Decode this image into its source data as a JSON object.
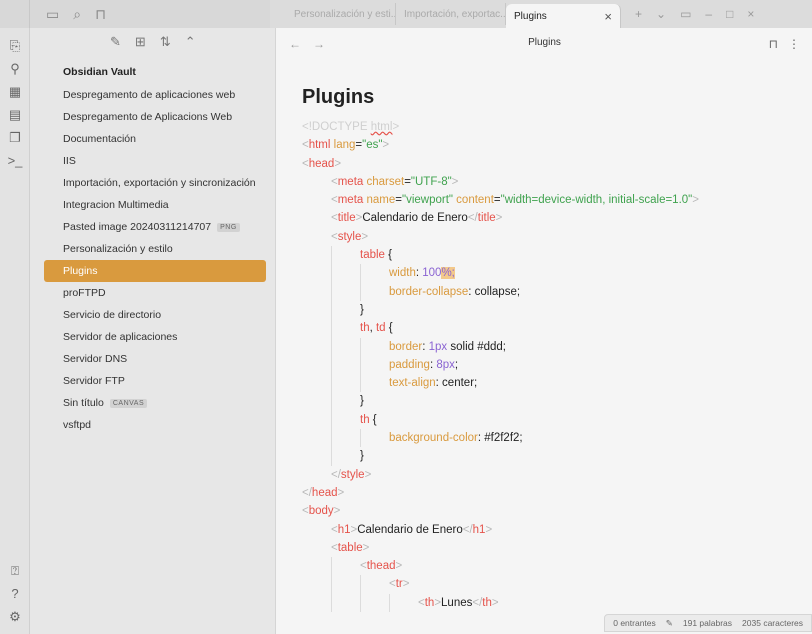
{
  "tabs": [
    {
      "label": "Personalización y esti..."
    },
    {
      "label": "Importación, exportac..."
    },
    {
      "label": "Plugins"
    }
  ],
  "view": {
    "title": "Plugins"
  },
  "sidebar": {
    "vault_name": "Obsidian Vault",
    "files": [
      {
        "name": "Despregamento de aplicaciones web",
        "badge": null
      },
      {
        "name": "Despregamento de Aplicacions Web",
        "badge": null
      },
      {
        "name": "Documentación",
        "badge": null
      },
      {
        "name": "IIS",
        "badge": null
      },
      {
        "name": "Importación, exportación y sincronización",
        "badge": null
      },
      {
        "name": "Integracion Multimedia",
        "badge": null
      },
      {
        "name": "Pasted image 20240311214707",
        "badge": "PNG"
      },
      {
        "name": "Personalización y estilo",
        "badge": null
      },
      {
        "name": "Plugins",
        "badge": null,
        "selected": true
      },
      {
        "name": "proFTPD",
        "badge": null
      },
      {
        "name": "Servicio de directorio",
        "badge": null
      },
      {
        "name": "Servidor de aplicaciones",
        "badge": null
      },
      {
        "name": "Servidor DNS",
        "badge": null
      },
      {
        "name": "Servidor FTP",
        "badge": null
      },
      {
        "name": "Sin título",
        "badge": "CANVAS"
      },
      {
        "name": "vsftpd",
        "badge": null
      }
    ]
  },
  "note": {
    "title": "Plugins",
    "code_lines": [
      {
        "indent": 0,
        "parts": [
          [
            "<!DOCTYPE ",
            "faint"
          ],
          [
            "html",
            "faint squiggle"
          ],
          [
            ">",
            "faint"
          ]
        ]
      },
      {
        "indent": 0,
        "parts": [
          [
            "<",
            "punct"
          ],
          [
            "html ",
            "tag"
          ],
          [
            "lang",
            "attr"
          ],
          [
            "=",
            "text"
          ],
          [
            "\"es\"",
            "str"
          ],
          [
            ">",
            "punct"
          ]
        ]
      },
      {
        "indent": 0,
        "parts": [
          [
            "<",
            "punct"
          ],
          [
            "head",
            "tag"
          ],
          [
            ">",
            "punct"
          ]
        ]
      },
      {
        "indent": 1,
        "parts": [
          [
            "<",
            "punct"
          ],
          [
            "meta ",
            "tag"
          ],
          [
            "charset",
            "attr"
          ],
          [
            "=",
            "text"
          ],
          [
            "\"UTF-8\"",
            "str"
          ],
          [
            ">",
            "punct"
          ]
        ]
      },
      {
        "indent": 1,
        "parts": [
          [
            "<",
            "punct"
          ],
          [
            "meta ",
            "tag"
          ],
          [
            "name",
            "attr"
          ],
          [
            "=",
            "text"
          ],
          [
            "\"viewport\" ",
            "str"
          ],
          [
            "content",
            "attr"
          ],
          [
            "=",
            "text"
          ],
          [
            "\"width=device-width, initial-scale=1.0\"",
            "str"
          ],
          [
            ">",
            "punct"
          ]
        ]
      },
      {
        "indent": 1,
        "parts": [
          [
            "<",
            "punct"
          ],
          [
            "title",
            "tag"
          ],
          [
            ">",
            "punct"
          ],
          [
            "Calendario de Enero",
            "text"
          ],
          [
            "</",
            "punct"
          ],
          [
            "title",
            "tag"
          ],
          [
            ">",
            "punct"
          ]
        ]
      },
      {
        "indent": 1,
        "parts": [
          [
            "<",
            "punct"
          ],
          [
            "style",
            "tag"
          ],
          [
            ">",
            "punct"
          ]
        ]
      },
      {
        "indent": 2,
        "parts": [
          [
            "table ",
            "tag"
          ],
          [
            "{",
            "text"
          ]
        ]
      },
      {
        "indent": 3,
        "parts": [
          [
            "width",
            "attr"
          ],
          [
            ": ",
            "text"
          ],
          [
            "100",
            "num"
          ],
          [
            "%;",
            "num highlight"
          ]
        ]
      },
      {
        "indent": 3,
        "parts": [
          [
            "border-collapse",
            "attr"
          ],
          [
            ": collapse;",
            "text"
          ]
        ]
      },
      {
        "indent": 2,
        "parts": [
          [
            "}",
            "text"
          ]
        ]
      },
      {
        "indent": 2,
        "parts": [
          [
            "th",
            "tag"
          ],
          [
            ", ",
            "text"
          ],
          [
            "td ",
            "tag"
          ],
          [
            "{",
            "text"
          ]
        ]
      },
      {
        "indent": 3,
        "parts": [
          [
            "border",
            "attr"
          ],
          [
            ": ",
            "text"
          ],
          [
            "1px",
            "num"
          ],
          [
            " solid #ddd;",
            "text"
          ]
        ]
      },
      {
        "indent": 3,
        "parts": [
          [
            "padding",
            "attr"
          ],
          [
            ": ",
            "text"
          ],
          [
            "8px",
            "num"
          ],
          [
            ";",
            "text"
          ]
        ]
      },
      {
        "indent": 3,
        "parts": [
          [
            "text-align",
            "attr"
          ],
          [
            ": center;",
            "text"
          ]
        ]
      },
      {
        "indent": 2,
        "parts": [
          [
            "}",
            "text"
          ]
        ]
      },
      {
        "indent": 2,
        "parts": [
          [
            "th ",
            "tag"
          ],
          [
            "{",
            "text"
          ]
        ]
      },
      {
        "indent": 3,
        "parts": [
          [
            "background-color",
            "attr"
          ],
          [
            ": #f2f2f2;",
            "text"
          ]
        ]
      },
      {
        "indent": 2,
        "parts": [
          [
            "}",
            "text"
          ]
        ]
      },
      {
        "indent": 1,
        "parts": [
          [
            "</",
            "punct"
          ],
          [
            "style",
            "tag"
          ],
          [
            ">",
            "punct"
          ]
        ]
      },
      {
        "indent": 0,
        "parts": [
          [
            "</",
            "punct"
          ],
          [
            "head",
            "tag"
          ],
          [
            ">",
            "punct"
          ]
        ]
      },
      {
        "indent": 0,
        "parts": [
          [
            "<",
            "punct"
          ],
          [
            "body",
            "tag"
          ],
          [
            ">",
            "punct"
          ]
        ]
      },
      {
        "indent": 1,
        "parts": [
          [
            "<",
            "punct"
          ],
          [
            "h1",
            "tag"
          ],
          [
            ">",
            "punct"
          ],
          [
            "Calendario de Enero",
            "text"
          ],
          [
            "</",
            "punct"
          ],
          [
            "h1",
            "tag"
          ],
          [
            ">",
            "punct"
          ]
        ]
      },
      {
        "indent": 1,
        "parts": [
          [
            "<",
            "punct"
          ],
          [
            "table",
            "tag"
          ],
          [
            ">",
            "punct"
          ]
        ]
      },
      {
        "indent": 2,
        "parts": [
          [
            "<",
            "punct"
          ],
          [
            "thead",
            "tag"
          ],
          [
            ">",
            "punct"
          ]
        ]
      },
      {
        "indent": 3,
        "parts": [
          [
            "<",
            "punct"
          ],
          [
            "tr",
            "tag"
          ],
          [
            ">",
            "punct"
          ]
        ]
      },
      {
        "indent": 4,
        "parts": [
          [
            "<",
            "punct"
          ],
          [
            "th",
            "tag"
          ],
          [
            ">",
            "punct"
          ],
          [
            "Lunes",
            "text"
          ],
          [
            "</",
            "punct"
          ],
          [
            "th",
            "tag"
          ],
          [
            ">",
            "punct"
          ]
        ]
      }
    ]
  },
  "status": {
    "backlinks": "0 entrantes",
    "words": "191 palabras",
    "chars": "2035 caracteres"
  },
  "colors": {
    "accent": "#d99a3e"
  },
  "icons": {
    "ribbon": [
      "open-quick-switcher-icon",
      "graph-view-icon",
      "canvas-icon",
      "daily-note-icon",
      "templates-icon",
      "command-palette-icon"
    ],
    "ribbon_bottom": [
      "vault-switcher-icon",
      "help-icon",
      "settings-icon"
    ]
  }
}
